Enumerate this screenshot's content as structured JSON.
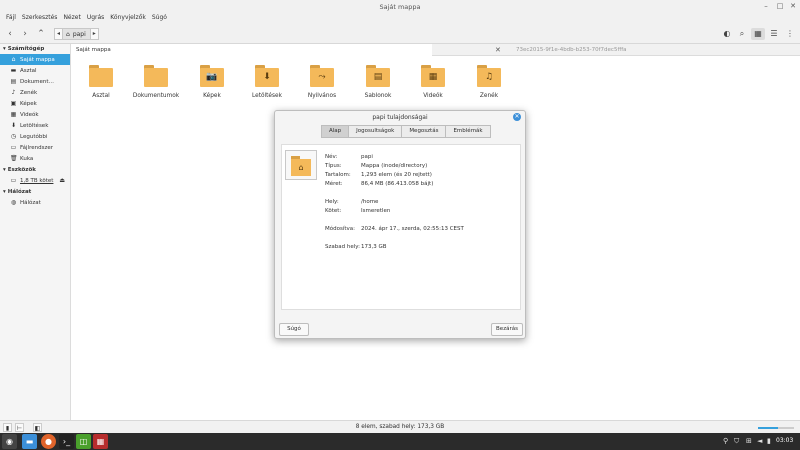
{
  "window": {
    "title": "Saját mappa"
  },
  "menubar": [
    "Fájl",
    "Szerkesztés",
    "Nézet",
    "Ugrás",
    "Könyvjelzők",
    "Súgó"
  ],
  "toolbar": {
    "path_chip": "papi"
  },
  "sidebar": {
    "sections": [
      {
        "title": "Számítógép",
        "items": [
          {
            "label": "Saját mappa",
            "icon": "home-icon",
            "active": true
          },
          {
            "label": "Asztal",
            "icon": "desktop-icon"
          },
          {
            "label": "Dokument…",
            "icon": "document-icon"
          },
          {
            "label": "Zenék",
            "icon": "music-icon"
          },
          {
            "label": "Képek",
            "icon": "picture-icon"
          },
          {
            "label": "Videók",
            "icon": "video-icon"
          },
          {
            "label": "Letöltések",
            "icon": "download-icon"
          },
          {
            "label": "Legutóbbi",
            "icon": "recent-icon"
          },
          {
            "label": "Fájlrendszer",
            "icon": "filesystem-icon"
          },
          {
            "label": "Kuka",
            "icon": "trash-icon"
          }
        ]
      },
      {
        "title": "Eszközök",
        "items": [
          {
            "label": "1,8 TB kötet",
            "icon": "drive-icon"
          }
        ]
      },
      {
        "title": "Hálózat",
        "items": [
          {
            "label": "Hálózat",
            "icon": "network-icon"
          }
        ]
      }
    ]
  },
  "tabs": {
    "active": "Saját mappa",
    "inactive": "73ec2015-9f1e-4bdb-b253-70f7dec5fffa"
  },
  "folders": [
    {
      "label": "Asztal",
      "glyph": ""
    },
    {
      "label": "Dokumentumok",
      "glyph": ""
    },
    {
      "label": "Képek",
      "glyph": "📷"
    },
    {
      "label": "Letöltések",
      "glyph": "⬇"
    },
    {
      "label": "Nyilvános",
      "glyph": "⤳"
    },
    {
      "label": "Sablonok",
      "glyph": "▤"
    },
    {
      "label": "Videók",
      "glyph": "▦"
    },
    {
      "label": "Zenék",
      "glyph": "♫"
    }
  ],
  "statusbar": {
    "text": "8 elem, szabad hely: 173,3 GB",
    "zoom_level": 0.55
  },
  "dialog": {
    "title": "papi tulajdonságai",
    "tabs": [
      "Alap",
      "Jogosultságok",
      "Megosztás",
      "Emblémák"
    ],
    "props": {
      "name_k": "Név:",
      "name_v": "papi",
      "type_k": "Típus:",
      "type_v": "Mappa (inode/directory)",
      "content_k": "Tartalom:",
      "content_v": "1,293 elem (és 20 rejtett)",
      "size_k": "Méret:",
      "size_v": "86,4 MB (86.413.058 bájt)",
      "location_k": "Hely:",
      "location_v": "/home",
      "volume_k": "Kötet:",
      "volume_v": "Ismeretlen",
      "modified_k": "Módosítva:",
      "modified_v": "2024. ápr 17., szerda, 02:55:13 CEST",
      "free_k": "Szabad hely:",
      "free_v": "173,3 GB"
    },
    "help_button": "Súgó",
    "close_button": "Bezárás"
  },
  "taskbar": {
    "clock": "03:03"
  }
}
